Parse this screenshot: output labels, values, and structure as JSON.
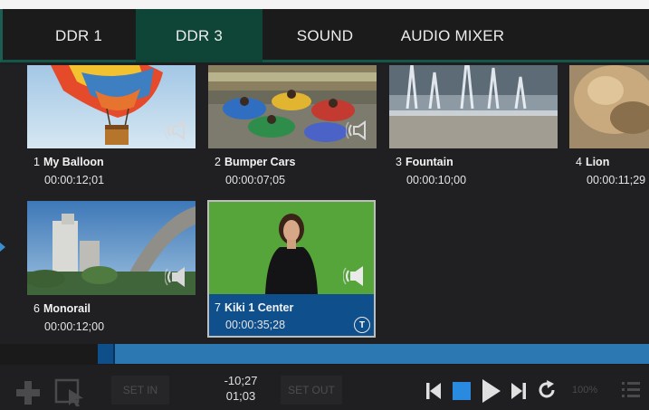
{
  "tabs": [
    {
      "label": "DDR 1"
    },
    {
      "label": "DDR 3",
      "active": true
    },
    {
      "label": "SOUND"
    },
    {
      "label": "AUDIO MIXER"
    }
  ],
  "clips": [
    {
      "number": "1",
      "name": "My Balloon",
      "duration": "00:00:12;01",
      "has_audio": true
    },
    {
      "number": "2",
      "name": "Bumper Cars",
      "duration": "00:00:07;05",
      "has_audio": true
    },
    {
      "number": "3",
      "name": "Fountain",
      "duration": "00:00:10;00",
      "has_audio": false
    },
    {
      "number": "4",
      "name": "Lion",
      "duration": "00:00:11;29",
      "has_audio": false
    },
    {
      "number": "6",
      "name": "Monorail",
      "duration": "00:00:12;00",
      "has_audio": true
    },
    {
      "number": "7",
      "name": "Kiki 1 Center",
      "duration": "00:00:35;28",
      "has_audio": true,
      "selected": true,
      "badge": "T"
    }
  ],
  "toolbar": {
    "set_in_label": "SET IN",
    "set_out_label": "SET OUT",
    "timecode_remaining": "-10;27",
    "timecode_elapsed": "01;03",
    "zoom": "100%"
  },
  "colors": {
    "active_tab": "#0e4536",
    "accent_teal": "#15564a",
    "selection_blue": "#0f4f8c",
    "scrub_blue": "#2b78b3",
    "transport_blue": "#2a8ae0"
  },
  "icons": [
    "add-icon",
    "select-tool-icon",
    "go-to-start-icon",
    "stop-icon",
    "play-icon",
    "go-to-end-icon",
    "loop-icon",
    "list-icon",
    "speaker-icon"
  ]
}
